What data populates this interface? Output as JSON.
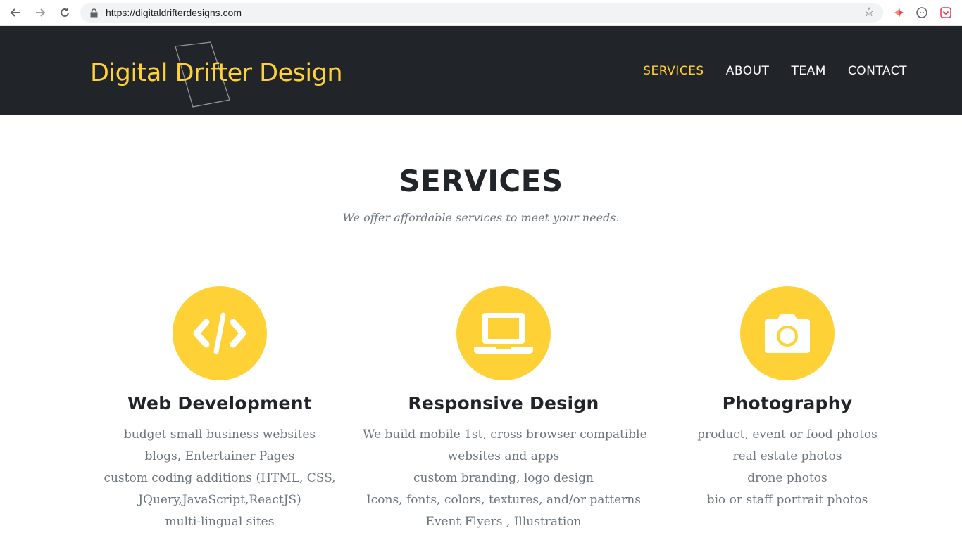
{
  "browser": {
    "url": "https://digitaldrifterdesigns.com",
    "back_icon": "arrow-left-icon",
    "forward_icon": "arrow-right-icon",
    "reload_icon": "reload-icon"
  },
  "header": {
    "brand": "Digital Drifter Design",
    "brand_color": "#fed136",
    "nav": [
      {
        "label": "SERVICES",
        "active": true
      },
      {
        "label": "ABOUT",
        "active": false
      },
      {
        "label": "TEAM",
        "active": false
      },
      {
        "label": "CONTACT",
        "active": false
      }
    ]
  },
  "services": {
    "heading": "SERVICES",
    "subheading": "We offer affordable services to meet your needs.",
    "items": [
      {
        "icon": "code-icon",
        "title": "Web Development",
        "lines": [
          "budget small business websites",
          "blogs, Entertainer Pages",
          "custom coding additions (HTML, CSS,",
          "JQuery,JavaScript,ReactJS)",
          "multi-lingual sites"
        ]
      },
      {
        "icon": "laptop-icon",
        "title": "Responsive Design",
        "lines": [
          "We build mobile 1st, cross browser compatible",
          "websites and apps",
          "custom branding, logo design",
          "Icons, fonts, colors, textures, and/or patterns",
          "Event Flyers , Illustration"
        ]
      },
      {
        "icon": "camera-icon",
        "title": "Photography",
        "lines": [
          "product, event or food photos",
          "real estate photos",
          "drone photos",
          "bio or staff portrait photos"
        ]
      }
    ]
  }
}
